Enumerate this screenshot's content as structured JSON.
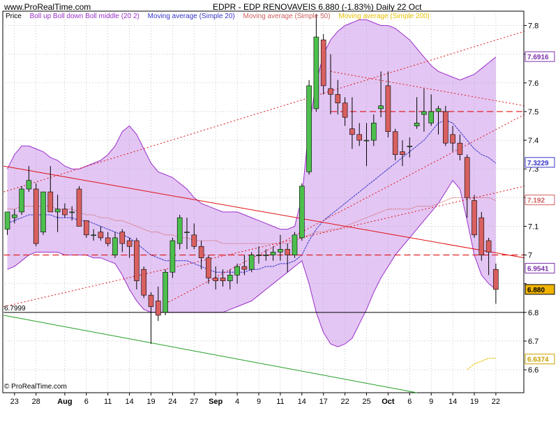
{
  "header": {
    "site": "www.ProRealTime.com",
    "title": "EDPR - EDP RENOVAVEIS    6.880 (-1.83%)   Daily  22 Oct"
  },
  "legend": [
    {
      "label": "Price",
      "color": "#000000"
    },
    {
      "label": "Boll up Boll down Boll middle (20 2)",
      "color": "#9b2fc9"
    },
    {
      "label": "Moving average (Simple 20)",
      "color": "#3535c8"
    },
    {
      "label": "Moving average (Simple 50)",
      "color": "#d06060"
    },
    {
      "label": "Moving average (Simple 200)",
      "color": "#e6c000"
    }
  ],
  "footer": "© ProRealTime.com",
  "colors": {
    "up": "#4cbf4c",
    "down": "#d96060",
    "band_fill": "#e3c6f4",
    "band_line": "#9b2fc9",
    "ma20": "#3535c8",
    "ma50": "#d06060",
    "ma200": "#e6c000",
    "trend_red": "#e01010",
    "trend_green": "#22a022",
    "grid": "#a0a0a0"
  },
  "chart_data": {
    "type": "candlestick",
    "ylim": [
      6.52,
      7.85
    ],
    "yticks": [
      6.6,
      6.7,
      6.8,
      6.9,
      7.0,
      7.1,
      7.2,
      7.3,
      7.4,
      7.5,
      7.6,
      7.7,
      7.8
    ],
    "ytick_labels": [
      "6.6",
      "6.7",
      "6.8",
      "",
      "7",
      "7.1",
      "7.2",
      "7.3",
      "7.4",
      "7.5",
      "7.6",
      "7.7",
      "7.8"
    ],
    "xlabels": [
      {
        "label": "23",
        "index": 1
      },
      {
        "label": "28",
        "index": 4
      },
      {
        "label": "Aug",
        "index": 8
      },
      {
        "label": "6",
        "index": 11
      },
      {
        "label": "11",
        "index": 14
      },
      {
        "label": "14",
        "index": 17
      },
      {
        "label": "19",
        "index": 20
      },
      {
        "label": "24",
        "index": 23
      },
      {
        "label": "27",
        "index": 26
      },
      {
        "label": "Sep",
        "index": 29
      },
      {
        "label": "4",
        "index": 32
      },
      {
        "label": "9",
        "index": 35
      },
      {
        "label": "11",
        "index": 38
      },
      {
        "label": "14",
        "index": 41
      },
      {
        "label": "17",
        "index": 44
      },
      {
        "label": "22",
        "index": 47
      },
      {
        "label": "25",
        "index": 50
      },
      {
        "label": "Oct",
        "index": 53
      },
      {
        "label": "6",
        "index": 56
      },
      {
        "label": "9",
        "index": 59
      },
      {
        "label": "14",
        "index": 62
      },
      {
        "label": "19",
        "index": 65
      },
      {
        "label": "22",
        "index": 68
      }
    ],
    "candles": [
      {
        "o": 7.09,
        "h": 7.15,
        "l": 7.07,
        "c": 7.15
      },
      {
        "o": 7.13,
        "h": 7.16,
        "l": 7.11,
        "c": 7.14
      },
      {
        "o": 7.15,
        "h": 7.24,
        "l": 7.14,
        "c": 7.23
      },
      {
        "o": 7.23,
        "h": 7.31,
        "l": 7.22,
        "c": 7.26
      },
      {
        "o": 7.23,
        "h": 7.25,
        "l": 7.03,
        "c": 7.04
      },
      {
        "o": 7.08,
        "h": 7.16,
        "l": 7.07,
        "c": 7.22
      },
      {
        "o": 7.22,
        "h": 7.31,
        "l": 7.15,
        "c": 7.15
      },
      {
        "o": 7.15,
        "h": 7.21,
        "l": 7.08,
        "c": 7.16
      },
      {
        "o": 7.16,
        "h": 7.18,
        "l": 7.13,
        "c": 7.14
      },
      {
        "o": 7.15,
        "h": 7.17,
        "l": 7.12,
        "c": 7.15
      },
      {
        "o": 7.23,
        "h": 7.24,
        "l": 7.1,
        "c": 7.1
      },
      {
        "o": 7.12,
        "h": 7.12,
        "l": 7.06,
        "c": 7.07
      },
      {
        "o": 7.07,
        "h": 7.09,
        "l": 7.05,
        "c": 7.07
      },
      {
        "o": 7.08,
        "h": 7.1,
        "l": 7.05,
        "c": 7.06
      },
      {
        "o": 7.06,
        "h": 7.08,
        "l": 7.03,
        "c": 7.04
      },
      {
        "o": 7.0,
        "h": 7.08,
        "l": 6.99,
        "c": 7.06
      },
      {
        "o": 7.08,
        "h": 7.09,
        "l": 7.01,
        "c": 7.04
      },
      {
        "o": 7.05,
        "h": 7.06,
        "l": 6.99,
        "c": 7.03
      },
      {
        "o": 7.05,
        "h": 7.06,
        "l": 6.88,
        "c": 6.91
      },
      {
        "o": 6.95,
        "h": 6.96,
        "l": 6.85,
        "c": 6.86
      },
      {
        "o": 6.86,
        "h": 6.87,
        "l": 6.69,
        "c": 6.82
      },
      {
        "o": 6.84,
        "h": 6.89,
        "l": 6.77,
        "c": 6.79
      },
      {
        "o": 6.8,
        "h": 6.95,
        "l": 6.79,
        "c": 6.94
      },
      {
        "o": 6.94,
        "h": 7.06,
        "l": 6.92,
        "c": 7.05
      },
      {
        "o": 7.04,
        "h": 7.14,
        "l": 7.02,
        "c": 7.13
      },
      {
        "o": 7.08,
        "h": 7.13,
        "l": 7.02,
        "c": 7.08
      },
      {
        "o": 7.07,
        "h": 7.11,
        "l": 7.02,
        "c": 7.03
      },
      {
        "o": 7.03,
        "h": 7.05,
        "l": 6.95,
        "c": 6.99
      },
      {
        "o": 6.99,
        "h": 7.0,
        "l": 6.9,
        "c": 6.92
      },
      {
        "o": 6.92,
        "h": 6.96,
        "l": 6.88,
        "c": 6.91
      },
      {
        "o": 6.92,
        "h": 6.95,
        "l": 6.89,
        "c": 6.91
      },
      {
        "o": 6.91,
        "h": 6.95,
        "l": 6.88,
        "c": 6.93
      },
      {
        "o": 6.93,
        "h": 6.97,
        "l": 6.9,
        "c": 6.96
      },
      {
        "o": 6.96,
        "h": 7.0,
        "l": 6.93,
        "c": 6.95
      },
      {
        "o": 6.95,
        "h": 7.01,
        "l": 6.94,
        "c": 7.0
      },
      {
        "o": 7.0,
        "h": 7.03,
        "l": 6.97,
        "c": 7.0
      },
      {
        "o": 7.0,
        "h": 7.02,
        "l": 6.98,
        "c": 7.0
      },
      {
        "o": 7.0,
        "h": 7.03,
        "l": 6.98,
        "c": 7.01
      },
      {
        "o": 7.01,
        "h": 7.07,
        "l": 6.98,
        "c": 7.02
      },
      {
        "o": 7.02,
        "h": 7.04,
        "l": 6.94,
        "c": 7.0
      },
      {
        "o": 7.0,
        "h": 7.08,
        "l": 6.99,
        "c": 7.07
      },
      {
        "o": 7.06,
        "h": 7.25,
        "l": 7.05,
        "c": 7.24
      },
      {
        "o": 7.29,
        "h": 7.61,
        "l": 7.28,
        "c": 7.59
      },
      {
        "o": 7.51,
        "h": 7.84,
        "l": 7.5,
        "c": 7.76
      },
      {
        "o": 7.75,
        "h": 7.77,
        "l": 7.56,
        "c": 7.59
      },
      {
        "o": 7.58,
        "h": 7.7,
        "l": 7.49,
        "c": 7.56
      },
      {
        "o": 7.56,
        "h": 7.61,
        "l": 7.49,
        "c": 7.53
      },
      {
        "o": 7.53,
        "h": 7.55,
        "l": 7.45,
        "c": 7.48
      },
      {
        "o": 7.44,
        "h": 7.55,
        "l": 7.37,
        "c": 7.42
      },
      {
        "o": 7.42,
        "h": 7.46,
        "l": 7.38,
        "c": 7.4
      },
      {
        "o": 7.4,
        "h": 7.46,
        "l": 7.31,
        "c": 7.4
      },
      {
        "o": 7.4,
        "h": 7.49,
        "l": 7.38,
        "c": 7.46
      },
      {
        "o": 7.51,
        "h": 7.64,
        "l": 7.48,
        "c": 7.52
      },
      {
        "o": 7.59,
        "h": 7.64,
        "l": 7.41,
        "c": 7.43
      },
      {
        "o": 7.43,
        "h": 7.44,
        "l": 7.33,
        "c": 7.35
      },
      {
        "o": 7.36,
        "h": 7.4,
        "l": 7.31,
        "c": 7.35
      },
      {
        "o": 7.38,
        "h": 7.41,
        "l": 7.34,
        "c": 7.38
      },
      {
        "o": 7.45,
        "h": 7.55,
        "l": 7.44,
        "c": 7.46
      },
      {
        "o": 7.49,
        "h": 7.58,
        "l": 7.43,
        "c": 7.5
      },
      {
        "o": 7.46,
        "h": 7.56,
        "l": 7.45,
        "c": 7.5
      },
      {
        "o": 7.5,
        "h": 7.52,
        "l": 7.42,
        "c": 7.51
      },
      {
        "o": 7.5,
        "h": 7.52,
        "l": 7.38,
        "c": 7.39
      },
      {
        "o": 7.42,
        "h": 7.45,
        "l": 7.36,
        "c": 7.39
      },
      {
        "o": 7.39,
        "h": 7.42,
        "l": 7.33,
        "c": 7.35
      },
      {
        "o": 7.34,
        "h": 7.35,
        "l": 7.13,
        "c": 7.2
      },
      {
        "o": 7.19,
        "h": 7.21,
        "l": 7.06,
        "c": 7.07
      },
      {
        "o": 7.13,
        "h": 7.15,
        "l": 6.98,
        "c": 7.0
      },
      {
        "o": 7.05,
        "h": 7.06,
        "l": 6.93,
        "c": 7.01
      },
      {
        "o": 6.95,
        "h": 6.97,
        "l": 6.83,
        "c": 6.88
      }
    ],
    "bollinger_upper": [
      7.3,
      7.35,
      7.38,
      7.38,
      7.37,
      7.36,
      7.34,
      7.33,
      7.31,
      7.3,
      7.3,
      7.31,
      7.32,
      7.33,
      7.35,
      7.38,
      7.43,
      7.45,
      7.42,
      7.37,
      7.32,
      7.29,
      7.28,
      7.27,
      7.25,
      7.23,
      7.2,
      7.18,
      7.17,
      7.16,
      7.15,
      7.15,
      7.15,
      7.14,
      7.13,
      7.12,
      7.11,
      7.1,
      7.09,
      7.09,
      7.1,
      7.2,
      7.45,
      7.6,
      7.7,
      7.75,
      7.78,
      7.8,
      7.81,
      7.82,
      7.82,
      7.81,
      7.8,
      7.8,
      7.79,
      7.77,
      7.75,
      7.72,
      7.69,
      7.66,
      7.64,
      7.63,
      7.62,
      7.61,
      7.62,
      7.63,
      7.65,
      7.67,
      7.69
    ],
    "bollinger_lower": [
      6.95,
      6.96,
      6.98,
      7.0,
      7.01,
      7.01,
      7.01,
      7.01,
      7.0,
      7.0,
      7.0,
      7.0,
      6.99,
      6.99,
      6.98,
      6.97,
      6.93,
      6.88,
      6.84,
      6.81,
      6.8,
      6.8,
      6.8,
      6.8,
      6.8,
      6.8,
      6.8,
      6.8,
      6.8,
      6.8,
      6.8,
      6.81,
      6.82,
      6.83,
      6.84,
      6.86,
      6.88,
      6.9,
      6.92,
      6.94,
      6.96,
      6.98,
      6.9,
      6.8,
      6.73,
      6.69,
      6.68,
      6.69,
      6.71,
      6.76,
      6.81,
      6.87,
      6.92,
      6.96,
      7.0,
      7.03,
      7.06,
      7.09,
      7.12,
      7.15,
      7.18,
      7.22,
      7.26,
      7.23,
      7.12,
      7.0,
      6.93,
      6.9,
      6.88
    ],
    "ma20": [
      7.11,
      7.12,
      7.13,
      7.14,
      7.14,
      7.14,
      7.14,
      7.13,
      7.13,
      7.13,
      7.12,
      7.12,
      7.11,
      7.1,
      7.09,
      7.08,
      7.07,
      7.06,
      7.04,
      7.02,
      7.0,
      6.99,
      6.98,
      6.98,
      6.98,
      6.98,
      6.97,
      6.96,
      6.95,
      6.94,
      6.94,
      6.94,
      6.94,
      6.94,
      6.95,
      6.95,
      6.96,
      6.96,
      6.97,
      6.97,
      6.98,
      7.0,
      7.05,
      7.09,
      7.12,
      7.14,
      7.16,
      7.18,
      7.2,
      7.22,
      7.24,
      7.26,
      7.28,
      7.3,
      7.32,
      7.34,
      7.36,
      7.38,
      7.4,
      7.43,
      7.46,
      7.47,
      7.46,
      7.43,
      7.4,
      7.37,
      7.35,
      7.34,
      7.32
    ],
    "ma50": [
      7.16,
      7.16,
      7.17,
      7.17,
      7.17,
      7.17,
      7.17,
      7.16,
      7.16,
      7.16,
      7.15,
      7.14,
      7.14,
      7.13,
      7.13,
      7.12,
      7.12,
      7.11,
      7.1,
      7.09,
      7.08,
      7.08,
      7.07,
      7.07,
      7.06,
      7.06,
      7.05,
      7.05,
      7.05,
      7.05,
      7.04,
      7.04,
      7.04,
      7.04,
      7.04,
      7.04,
      7.04,
      7.04,
      7.04,
      7.04,
      7.05,
      7.06,
      7.07,
      7.08,
      7.08,
      7.09,
      7.09,
      7.1,
      7.11,
      7.12,
      7.13,
      7.14,
      7.15,
      7.16,
      7.16,
      7.16,
      7.16,
      7.17,
      7.17,
      7.17,
      7.18,
      7.19,
      7.2,
      7.2,
      7.2,
      7.2,
      7.2,
      7.2,
      7.19
    ],
    "ma200": {
      "start_index": 64,
      "values": [
        6.6,
        6.62,
        6.63,
        6.64,
        6.64
      ]
    },
    "trendlines": [
      {
        "name": "red_solid",
        "i1": -0.5,
        "v1": 7.31,
        "i2": 72,
        "v2": 6.99,
        "style": "solid",
        "color": "#e01010"
      },
      {
        "name": "red_dot_top",
        "i1": -0.5,
        "v1": 7.22,
        "i2": 72,
        "v2": 7.78,
        "style": "dotted",
        "color": "#e01010"
      },
      {
        "name": "red_dot_mid",
        "i1": -0.5,
        "v1": 6.82,
        "i2": 72,
        "v2": 7.24,
        "style": "dotted",
        "color": "#e01010"
      },
      {
        "name": "red_dot_desc",
        "i1": 45,
        "v1": 7.64,
        "i2": 72,
        "v2": 7.52,
        "style": "dotted",
        "color": "#e01010"
      },
      {
        "name": "red_dot_low",
        "i1": 22,
        "v1": 6.83,
        "i2": 72,
        "v2": 7.49,
        "style": "dotted",
        "color": "#e01010"
      },
      {
        "name": "red_dash_70",
        "i1": -0.5,
        "v1": 7.0,
        "i2": 72,
        "v2": 7.0,
        "style": "dashed",
        "color": "#e01010"
      },
      {
        "name": "red_dash_75",
        "i1": 45,
        "v1": 7.5,
        "i2": 72,
        "v2": 7.5,
        "style": "dashed",
        "color": "#e01010"
      },
      {
        "name": "black_support",
        "i1": -0.5,
        "v1": 6.8,
        "i2": 72,
        "v2": 6.8,
        "style": "solid",
        "color": "#000000"
      },
      {
        "name": "green_trend",
        "i1": -0.5,
        "v1": 6.79,
        "i2": 57,
        "v2": 6.52,
        "style": "solid",
        "color": "#22a022"
      }
    ],
    "level_label": "6.7999",
    "price_labels": [
      {
        "value": 7.6916,
        "text": "7.6916",
        "color": "#7b2fa9"
      },
      {
        "value": 7.3229,
        "text": "7.3229",
        "color": "#3535c8"
      },
      {
        "value": 7.192,
        "text": "7.192",
        "color": "#d06060"
      },
      {
        "value": 6.9541,
        "text": "6.9541",
        "color": "#7b2fa9"
      },
      {
        "value": 6.88,
        "text": "6.880",
        "color": "#000000"
      },
      {
        "value": 6.6374,
        "text": "6.6374",
        "color": "#c8a000"
      }
    ]
  }
}
